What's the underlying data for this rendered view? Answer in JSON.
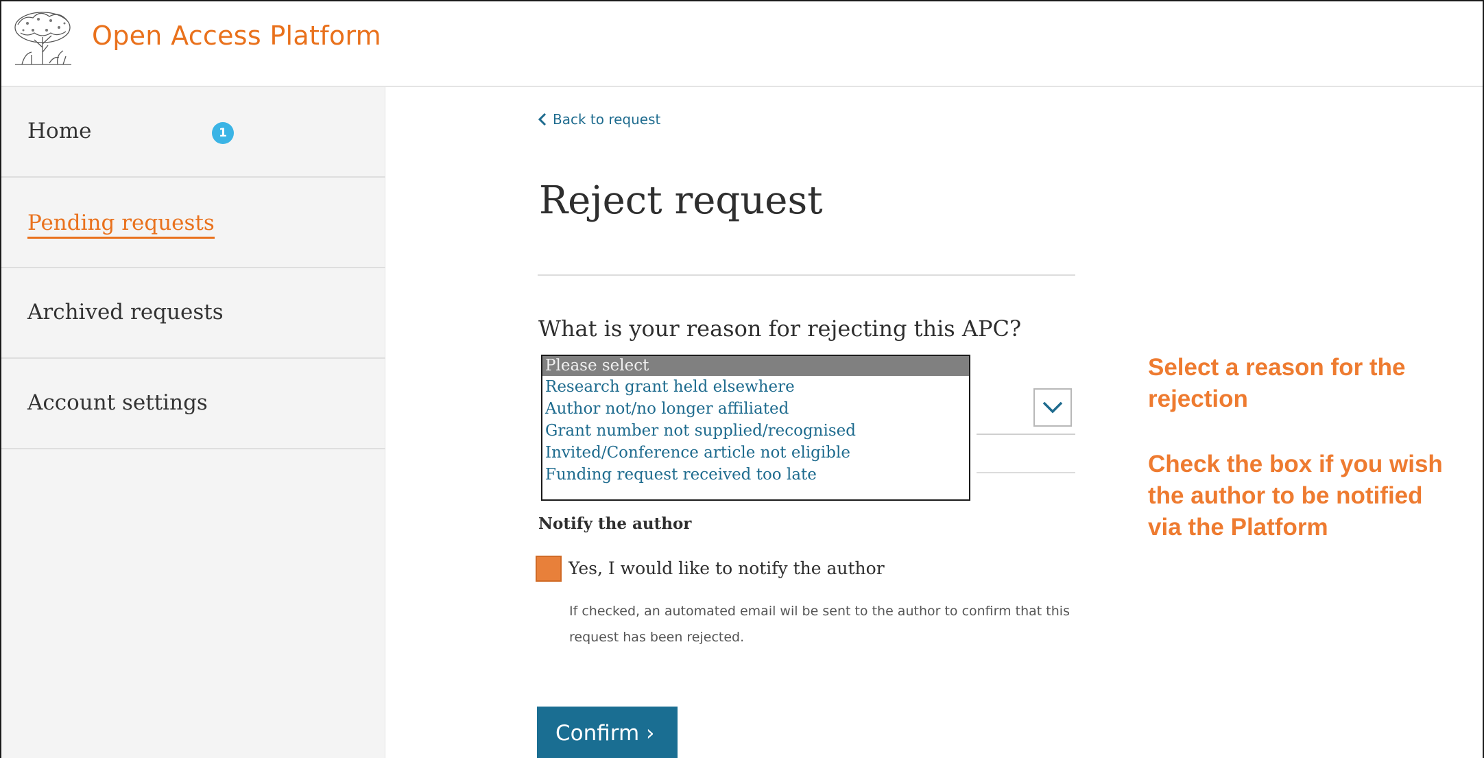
{
  "header": {
    "title": "Open Access Platform",
    "logo_icon": "tree-logo-icon"
  },
  "sidebar": {
    "items": [
      {
        "label": "Home",
        "active": false
      },
      {
        "label": "Pending requests",
        "active": true,
        "badge": "1"
      },
      {
        "label": "Archived requests",
        "active": false
      },
      {
        "label": "Account settings",
        "active": false
      }
    ]
  },
  "main": {
    "back_link": "Back to request",
    "title": "Reject request",
    "question": "What is your reason for rejecting this APC?",
    "reason_select": {
      "placeholder": "Please select",
      "options": [
        "Research grant held elsewhere",
        "Author not/no longer affiliated",
        "Grant number not supplied/recognised",
        "Invited/Conference article not eligible",
        "Funding request received too late"
      ]
    },
    "notify_heading": "Notify the author",
    "notify_checkbox_label": "Yes, I would like to notify the author",
    "notify_checked": true,
    "helper_text": "If checked, an automated email wil be sent to the author to confirm that this request has been rejected.",
    "confirm_label": "Confirm ›"
  },
  "annotations": {
    "select_hint": "Select a reason for the rejection",
    "checkbox_hint": "Check the box if you wish the author to be notified via the Platform"
  },
  "colors": {
    "accent": "#e9711c",
    "link": "#1e6b8e",
    "badge": "#3bb4e5",
    "button": "#1a6e92",
    "checkbox": "#e8803a"
  }
}
